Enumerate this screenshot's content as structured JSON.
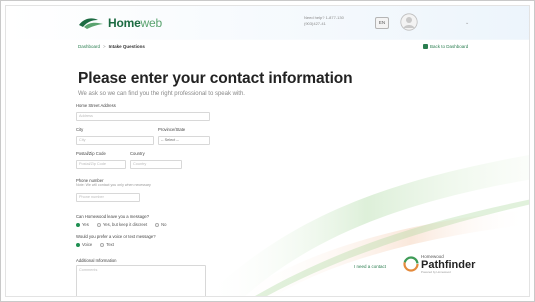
{
  "header": {
    "brand_main": "Home",
    "brand_accent": "web",
    "contact_line_1": "Need help? 1-877-130",
    "contact_line_2": "(903)427-41",
    "lang_button": "EN"
  },
  "breadcrumb": {
    "items": [
      "Dashboard",
      "Intake Questions"
    ],
    "separator": ">",
    "back_label": "Back to Dashboard"
  },
  "main": {
    "title": "Please enter your contact information",
    "subtitle": "We ask so we can find you the right professional to speak with."
  },
  "form": {
    "street_label": "Home Street Address",
    "street_placeholder": "Address",
    "city_label": "City",
    "city_placeholder": "City",
    "province_label": "Province/State",
    "province_value": "-- Select --",
    "postal_label": "Postal/Zip Code",
    "postal_placeholder": "Postal/Zip Code",
    "country_label": "Country",
    "country_placeholder": "Country",
    "phone_label": "Phone number",
    "phone_hint": "Note: We will contact you only when necessary",
    "phone_placeholder": "Phone number",
    "message_question": "Can Homewood leave you a message?",
    "message_options": [
      "Yes",
      "Yes, but keep it discreet",
      "No"
    ],
    "message_selected": 0,
    "contact_question": "Would you prefer a voice or text message?",
    "contact_options": [
      "Voice",
      "Text"
    ],
    "contact_selected": 0,
    "additional_label": "Additional Information",
    "additional_placeholder": "Comments"
  },
  "footer": {
    "next_link": "I need a contact",
    "pathfinder_top": "Homewood",
    "pathfinder_main": "Pathfinder",
    "pathfinder_sub": "Powered by Homewood"
  },
  "colors": {
    "brand_green": "#1c6b42",
    "accent_green": "#1f8f52",
    "link_green": "#2a7d4f"
  }
}
